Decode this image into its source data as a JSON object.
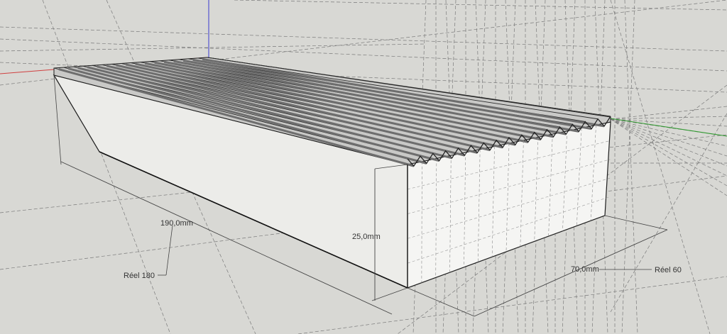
{
  "viewport": {
    "background": "#d8d8d4"
  },
  "model": {
    "shape": "grooved block",
    "groove_count": 16
  },
  "dimensions": {
    "length": "190,0mm",
    "height": "25,0mm",
    "width": "70,0mm"
  },
  "annotations": {
    "length_real": "Réel 180",
    "width_real": "Réel 60"
  },
  "colors": {
    "axis_red": "#d04040",
    "axis_green": "#2f9a2f",
    "axis_blue": "#3a3ad0",
    "face_light": "#ededeb",
    "face_front": "#f4f4f2",
    "groove_dark": "#6e6e6e",
    "edge": "#1e1e1e",
    "guide": "#6a6a6a"
  }
}
